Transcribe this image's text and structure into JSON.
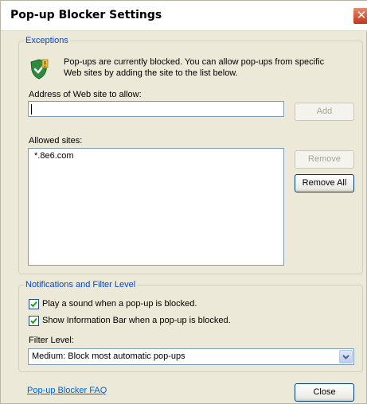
{
  "window": {
    "title": "Pop-up Blocker Settings",
    "close_glyph": "✕"
  },
  "exceptions": {
    "legend": "Exceptions",
    "description_line1": "Pop-ups are currently blocked.  You can allow pop-ups from specific",
    "description_line2": "Web sites by adding the site to the list below.",
    "address_label": "Address of Web site to allow:",
    "address_value": "",
    "add_label": "Add",
    "allowed_label": "Allowed sites:",
    "allowed_sites": [
      "*.8e6.com"
    ],
    "remove_label": "Remove",
    "remove_all_label": "Remove All",
    "icon": "shield-check-icon"
  },
  "notifications": {
    "legend": "Notifications and Filter Level",
    "play_sound_label": "Play a sound when a pop-up is blocked.",
    "play_sound_checked": true,
    "info_bar_label": "Show Information Bar when a pop-up is blocked.",
    "info_bar_checked": true,
    "filter_label": "Filter Level:",
    "filter_value": "Medium: Block most automatic pop-ups"
  },
  "footer": {
    "faq_link": "Pop-up Blocker FAQ",
    "close_label": "Close"
  },
  "colors": {
    "accent": "#0046d5",
    "link": "#0066cc",
    "dialog_bg": "#ece9d8"
  }
}
